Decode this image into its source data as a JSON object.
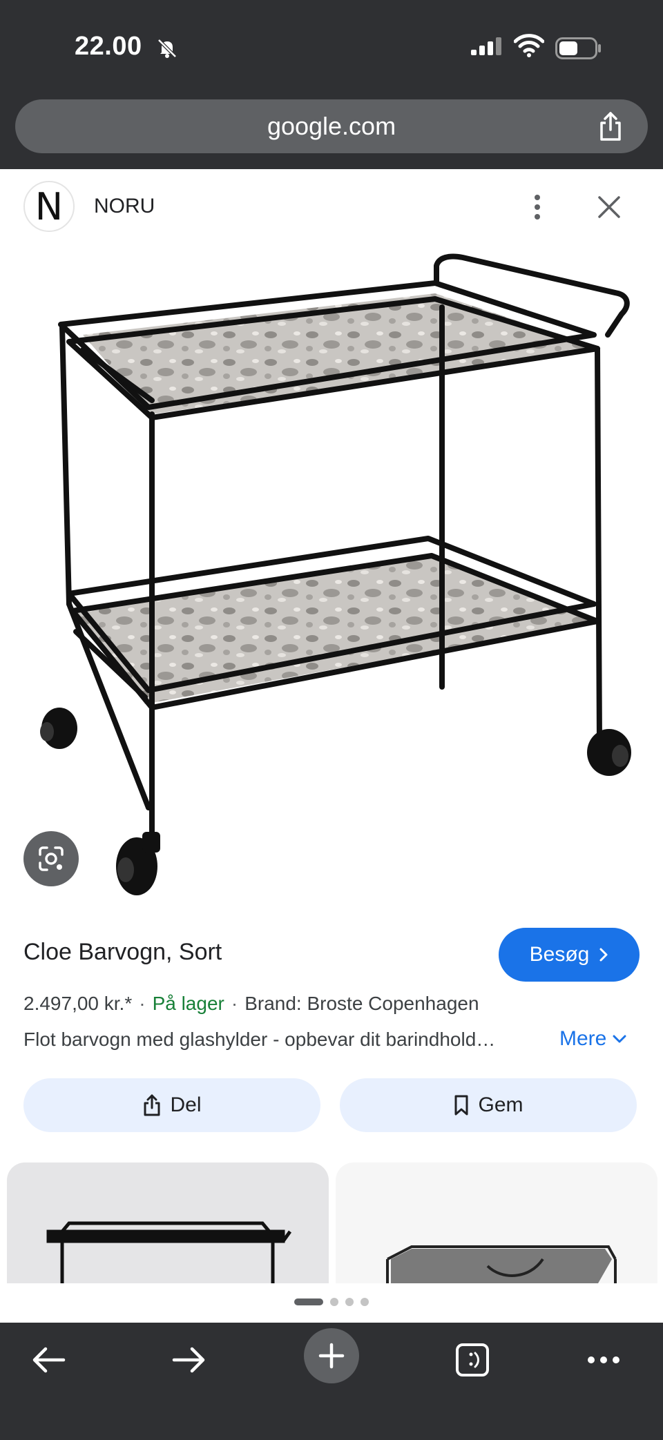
{
  "status": {
    "time": "22.00"
  },
  "browser": {
    "url": "google.com"
  },
  "source": {
    "logo_letter": "N",
    "name": "NORU"
  },
  "product": {
    "title": "Cloe Barvogn, Sort",
    "visit_label": "Besøg",
    "price": "2.497,00 kr.*",
    "stock": "På lager",
    "brand": "Brand: Broste Copenhagen",
    "description": "Flot barvogn med glashylder - opbevar dit barindhold…",
    "more_label": "Mere",
    "share_label": "Del",
    "save_label": "Gem"
  },
  "carousel": {
    "page_count": 4,
    "active_index": 0
  },
  "colors": {
    "accent": "#1a73e8",
    "stock_green": "#188038",
    "chrome_dark": "#2f3033",
    "pill_bg": "#e8f0fe"
  },
  "icons": [
    "bell-off-icon",
    "signal-icon",
    "wifi-icon",
    "battery-icon",
    "share-icon",
    "kebab-menu-icon",
    "close-icon",
    "lens-icon",
    "chevron-right-icon",
    "chevron-down-icon",
    "bookmark-icon",
    "back-arrow-icon",
    "forward-arrow-icon",
    "plus-icon",
    "tabs-icon",
    "more-icon"
  ]
}
